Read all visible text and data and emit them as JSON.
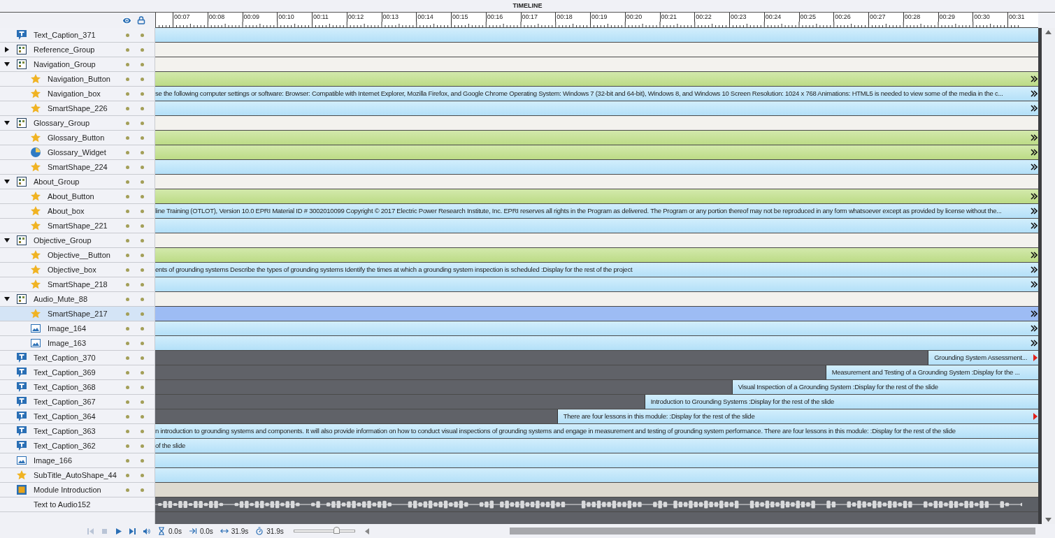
{
  "panel": {
    "title": "TIMELINE"
  },
  "ruler": {
    "labels": [
      "00:07",
      "00:08",
      "00:09",
      "00:10",
      "00:11",
      "00:12",
      "00:13",
      "00:14",
      "00:15",
      "00:16",
      "00:17",
      "00:18",
      "00:19",
      "00:20",
      "00:21",
      "00:22",
      "00:23",
      "00:24",
      "00:25",
      "00:26",
      "00:27",
      "00:28",
      "00:29",
      "00:30",
      "00:31"
    ]
  },
  "layers": [
    {
      "name": "Text_Caption_371",
      "kind": "caption",
      "selected": false,
      "bar": {
        "kind": "object"
      }
    },
    {
      "name": "Reference_Group",
      "kind": "group",
      "selected": false,
      "expanded": false,
      "bar": {
        "kind": "group"
      }
    },
    {
      "name": "Navigation_Group",
      "kind": "group",
      "selected": false,
      "expanded": true,
      "bar": {
        "kind": "group"
      },
      "children": [
        {
          "name": "Navigation_Button",
          "kind": "star",
          "selected": false,
          "bar": {
            "kind": "interactive",
            "end": {
              "kind": "more"
            }
          }
        },
        {
          "name": "Navigation_box",
          "kind": "star",
          "selected": false,
          "bar": {
            "kind": "object",
            "end": {
              "kind": "more"
            },
            "text": "se the following computer settings or software:  Browser: Compatible with Internet Explorer, Mozilla Firefox, and Google Chrome Operating System: Windows 7 (32-bit and 64-bit), Windows 8, and Windows 10 Screen Resolution: 1024 x 768  Animations: HTML5 is needed to view some of the media in the c..."
          }
        },
        {
          "name": "SmartShape_226",
          "kind": "star",
          "selected": false,
          "bar": {
            "kind": "object",
            "end": {
              "kind": "more"
            }
          }
        }
      ]
    },
    {
      "name": "Glossary_Group",
      "kind": "group",
      "selected": false,
      "expanded": true,
      "bar": {
        "kind": "group"
      },
      "children": [
        {
          "name": "Glossary_Button",
          "kind": "star",
          "selected": false,
          "bar": {
            "kind": "interactive",
            "end": {
              "kind": "more"
            }
          }
        },
        {
          "name": "Glossary_Widget",
          "kind": "widget",
          "selected": false,
          "bar": {
            "kind": "interactive",
            "end": {
              "kind": "more"
            }
          }
        },
        {
          "name": "SmartShape_224",
          "kind": "star",
          "selected": false,
          "bar": {
            "kind": "object",
            "end": {
              "kind": "more"
            }
          }
        }
      ]
    },
    {
      "name": "About_Group",
      "kind": "group",
      "selected": false,
      "expanded": true,
      "bar": {
        "kind": "group"
      },
      "children": [
        {
          "name": "About_Button",
          "kind": "star",
          "selected": false,
          "bar": {
            "kind": "interactive",
            "end": {
              "kind": "more"
            }
          }
        },
        {
          "name": "About_box",
          "kind": "star",
          "selected": false,
          "bar": {
            "kind": "object",
            "end": {
              "kind": "more"
            },
            "text": "line Training (OTLOT), Version 10.0 EPRI Material ID # 3002010099  Copyright © 2017 Electric Power Research Institute, Inc.  EPRI reserves all rights in the Program as delivered. The Program or any portion thereof may not be reproduced in any form whatsoever except as provided by license without the..."
          }
        },
        {
          "name": "SmartShape_221",
          "kind": "star",
          "selected": false,
          "bar": {
            "kind": "object",
            "end": {
              "kind": "more"
            }
          }
        }
      ]
    },
    {
      "name": "Objective_Group",
      "kind": "group",
      "selected": false,
      "expanded": true,
      "bar": {
        "kind": "group"
      },
      "children": [
        {
          "name": "Objective__Button",
          "kind": "star",
          "selected": false,
          "bar": {
            "kind": "interactive",
            "end": {
              "kind": "more"
            }
          }
        },
        {
          "name": "Objective_box",
          "kind": "star",
          "selected": false,
          "bar": {
            "kind": "object",
            "end": {
              "kind": "more"
            },
            "text": "ents of grounding systems  Describe the types of grounding systems Identify the times at which a grounding system inspection is scheduled   :Display for the rest of the project"
          }
        },
        {
          "name": "SmartShape_218",
          "kind": "star",
          "selected": false,
          "bar": {
            "kind": "object",
            "end": {
              "kind": "more"
            }
          }
        }
      ]
    },
    {
      "name": "Audio_Mute_88",
      "kind": "group",
      "selected": false,
      "expanded": true,
      "bar": {
        "kind": "group"
      },
      "children": [
        {
          "name": "SmartShape_217",
          "kind": "star",
          "selected": true,
          "bar": {
            "kind": "object",
            "end": {
              "kind": "more"
            }
          }
        },
        {
          "name": "Image_164",
          "kind": "image",
          "selected": false,
          "bar": {
            "kind": "object",
            "end": {
              "kind": "more"
            }
          }
        },
        {
          "name": "Image_163",
          "kind": "image",
          "selected": false,
          "bar": {
            "kind": "object",
            "end": {
              "kind": "more"
            }
          }
        }
      ]
    },
    {
      "name": "Text_Caption_370",
      "kind": "caption",
      "selected": false,
      "bar": {
        "kind": "object",
        "level": 0.125,
        "end": {
          "kind": "marker"
        },
        "text": "Grounding System Assessment..."
      }
    },
    {
      "name": "Text_Caption_369",
      "kind": "caption",
      "selected": false,
      "bar": {
        "kind": "object",
        "level": 0.241,
        "text": "Measurement and Testing of a Grounding System   :Display for the ..."
      }
    },
    {
      "name": "Text_Caption_368",
      "kind": "caption",
      "selected": false,
      "bar": {
        "kind": "object",
        "level": 0.347,
        "text": "Visual Inspection of a Grounding System   :Display for the rest of the slide"
      }
    },
    {
      "name": "Text_Caption_367",
      "kind": "caption",
      "selected": false,
      "bar": {
        "kind": "object",
        "level": 0.446,
        "text": "Introduction to Grounding Systems   :Display for the rest of the slide"
      }
    },
    {
      "name": "Text_Caption_364",
      "kind": "caption",
      "selected": false,
      "bar": {
        "kind": "object",
        "level": 0.545,
        "end": {
          "kind": "marker"
        },
        "text": "There are four lessons in this module:   :Display for the rest of the slide"
      }
    },
    {
      "name": "Text_Caption_363",
      "kind": "caption",
      "selected": false,
      "bar": {
        "kind": "object",
        "text": "n introduction to grounding systems and components. It will also provide information on how to conduct visual inspections of grounding systems and engage in measurement and testing of grounding system performance.    There are four lessons in this module:   :Display for the rest of the slide"
      }
    },
    {
      "name": "Text_Caption_362",
      "kind": "caption",
      "selected": false,
      "bar": {
        "kind": "object",
        "text": "of the slide"
      }
    },
    {
      "name": "Image_166",
      "kind": "image",
      "selected": false,
      "bar": {
        "kind": "object"
      }
    },
    {
      "name": "SubTitle_AutoShape_44",
      "kind": "star",
      "selected": false,
      "bar": {
        "kind": "object"
      }
    },
    {
      "name": "Module Introduction",
      "kind": "slide",
      "selected": false,
      "bar": {
        "kind": "slide"
      }
    },
    {
      "name": "Text to Audio152",
      "kind": "audio",
      "selected": false,
      "bar": {
        "kind": "audio"
      }
    }
  ],
  "controls": [
    {
      "kind": "first",
      "disabled": true
    },
    {
      "kind": "stop",
      "disabled": true
    },
    {
      "kind": "play",
      "disabled": false
    },
    {
      "kind": "last",
      "disabled": false
    },
    {
      "kind": "volume",
      "disabled": false
    }
  ],
  "readouts": [
    {
      "kind": "current",
      "value": "0.0s"
    },
    {
      "kind": "start",
      "value": "0.0s"
    },
    {
      "kind": "end",
      "value": "31.9s"
    },
    {
      "kind": "duration",
      "value": "31.9s"
    }
  ],
  "zoom": {
    "level": 0.7
  }
}
